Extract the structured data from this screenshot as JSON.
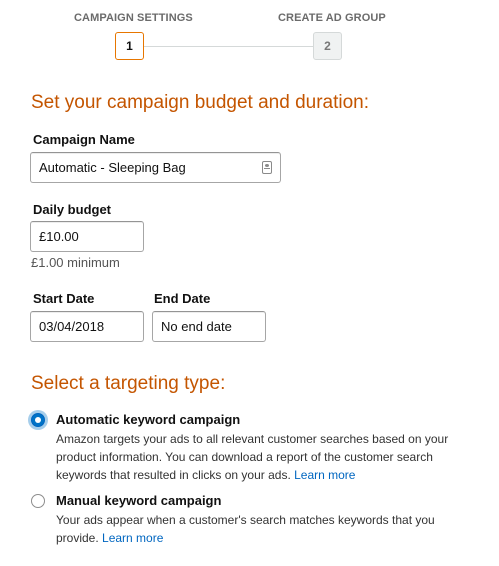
{
  "stepper": {
    "steps": [
      {
        "label": "CAMPAIGN SETTINGS",
        "number": "1",
        "active": true
      },
      {
        "label": "CREATE AD GROUP",
        "number": "2",
        "active": false
      }
    ]
  },
  "budget_section": {
    "title": "Set your campaign budget and duration:",
    "campaign_name": {
      "label": "Campaign Name",
      "value": "Automatic - Sleeping Bag"
    },
    "daily_budget": {
      "label": "Daily budget",
      "value": "£10.00",
      "hint": "£1.00 minimum"
    },
    "start_date": {
      "label": "Start Date",
      "value": "03/04/2018"
    },
    "end_date": {
      "label": "End Date",
      "value": "No end date"
    }
  },
  "targeting_section": {
    "title": "Select a targeting type:",
    "options": [
      {
        "title": "Automatic keyword campaign",
        "line1": "Amazon targets your ads to all relevant customer searches based on your",
        "line2": "product information. You can download a report of the customer search",
        "line3": "keywords that resulted in clicks on your ads. ",
        "link": "Learn more",
        "selected": true
      },
      {
        "title": "Manual keyword campaign",
        "line1": "Your ads appear when a customer's search matches keywords that you",
        "line2": "provide. ",
        "link": "Learn more",
        "selected": false
      }
    ]
  },
  "colors": {
    "accent": "#c45500",
    "link": "#0066c0",
    "step_active_border": "#e77600"
  }
}
